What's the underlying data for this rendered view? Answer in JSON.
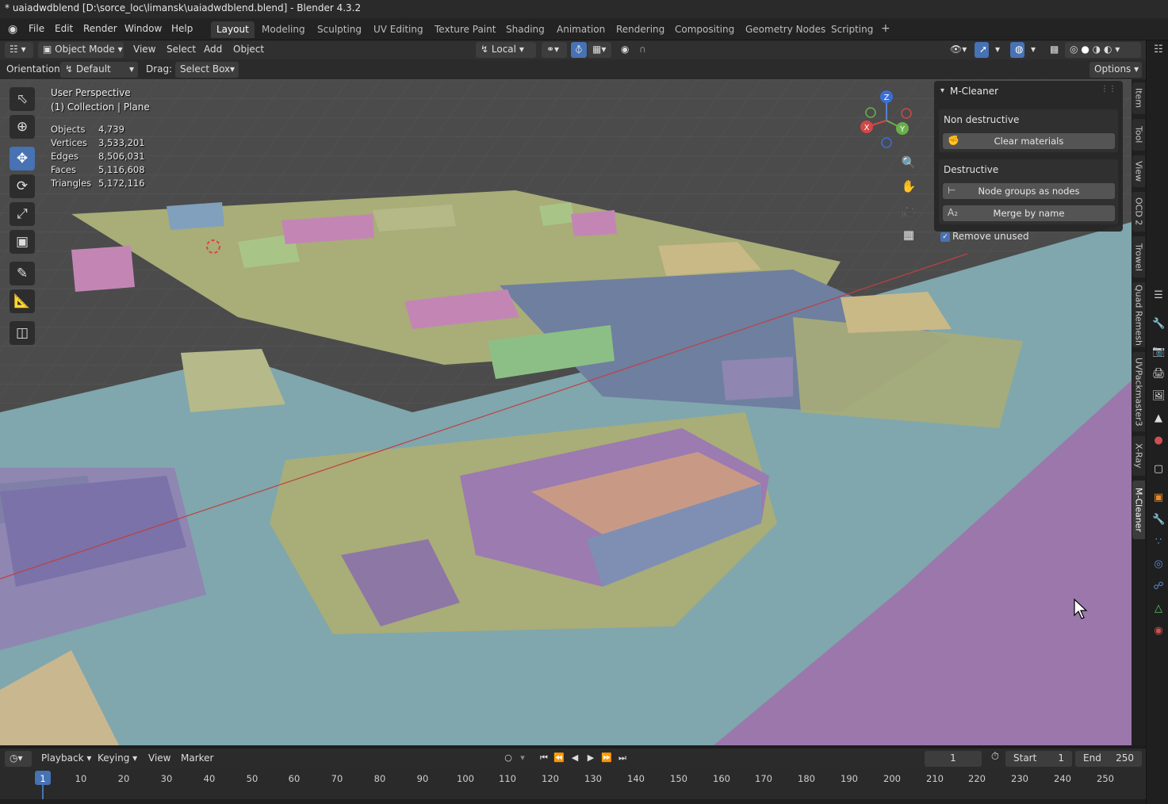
{
  "window": {
    "title": "* uaiadwdblend [D:\\sorce_loc\\limansk\\uaiadwdblend.blend] - Blender 4.3.2"
  },
  "menu": {
    "items": [
      "File",
      "Edit",
      "Render",
      "Window",
      "Help"
    ]
  },
  "workspaces": {
    "tabs": [
      "Layout",
      "Modeling",
      "Sculpting",
      "UV Editing",
      "Texture Paint",
      "Shading",
      "Animation",
      "Rendering",
      "Compositing",
      "Geometry Nodes",
      "Scripting"
    ],
    "active": "Layout",
    "add_symbol": "+"
  },
  "header": {
    "mode": "Object Mode",
    "menus": [
      "View",
      "Select",
      "Add",
      "Object"
    ],
    "transform_space": "Local"
  },
  "subheader": {
    "orientation_label": "Orientation:",
    "orientation_value": "Default",
    "drag_label": "Drag:",
    "drag_value": "Select Box",
    "options": "Options"
  },
  "viewport": {
    "perspective": "User Perspective",
    "collection": "(1) Collection | Plane",
    "stats": [
      {
        "label": "Objects",
        "value": "4,739"
      },
      {
        "label": "Vertices",
        "value": "3,533,201"
      },
      {
        "label": "Edges",
        "value": "8,506,031"
      },
      {
        "label": "Faces",
        "value": "5,116,608"
      },
      {
        "label": "Triangles",
        "value": "5,172,116"
      }
    ],
    "gizmo": {
      "x": "X",
      "y": "Y",
      "z": "Z"
    }
  },
  "panel": {
    "title": "M-Cleaner",
    "non_destructive_label": "Non destructive",
    "clear_materials": "Clear materials",
    "destructive_label": "Destructive",
    "node_groups": "Node groups as nodes",
    "merge_by_name": "Merge by name",
    "merge_icon": "A₂",
    "remove_unused": "Remove unused"
  },
  "sidebar_tabs": [
    "Item",
    "Tool",
    "View",
    "OCD 2",
    "Trowel",
    "Quad Remesh",
    "UVPackmaster3",
    "X-Ray",
    "M-Cleaner"
  ],
  "sidebar_active": "M-Cleaner",
  "timeline": {
    "menus": [
      "Playback",
      "Keying",
      "View",
      "Marker"
    ],
    "current_frame": "1",
    "start_label": "Start",
    "start_value": "1",
    "end_label": "End",
    "end_value": "250",
    "ticks": [
      "1",
      "10",
      "20",
      "30",
      "40",
      "50",
      "60",
      "70",
      "80",
      "90",
      "100",
      "110",
      "120",
      "130",
      "140",
      "150",
      "160",
      "170",
      "180",
      "190",
      "200",
      "210",
      "220",
      "230",
      "240",
      "250"
    ]
  }
}
